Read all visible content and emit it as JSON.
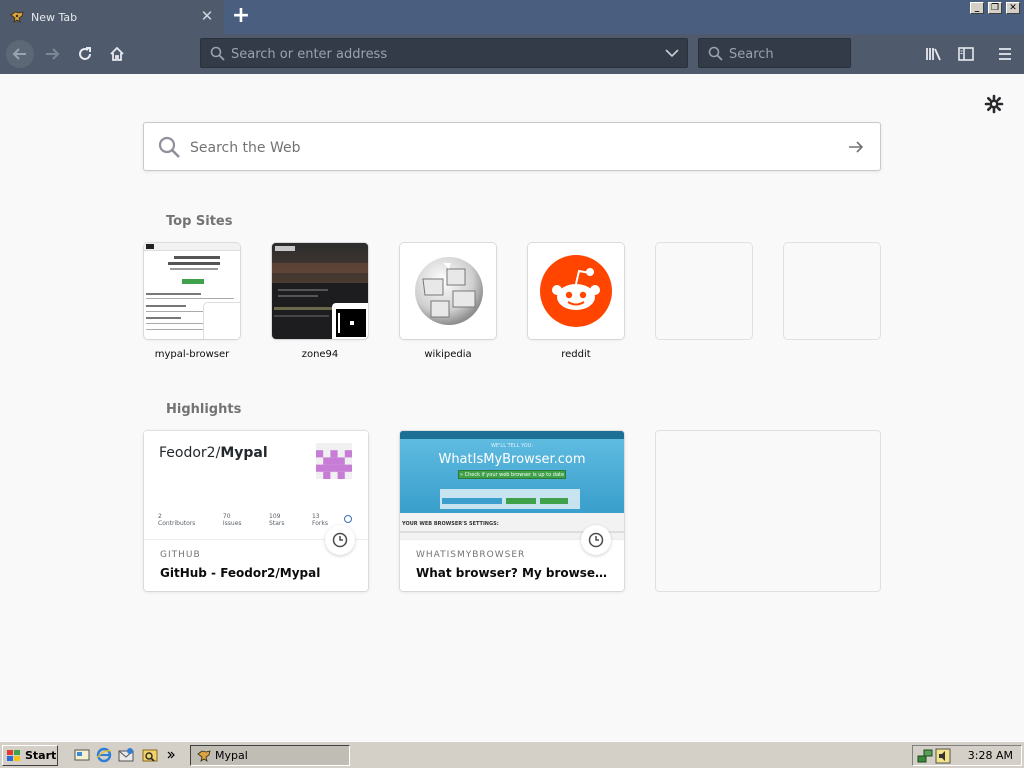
{
  "window": {
    "tab_title": "New Tab",
    "new_tab_symbol": "+",
    "close_tab_symbol": "✕",
    "min_symbol": "_",
    "max_symbol": "❐",
    "close_symbol": "✕"
  },
  "toolbar": {
    "address_placeholder": "Search or enter address",
    "search_placeholder": "Search"
  },
  "newtab": {
    "web_search_placeholder": "Search the Web",
    "top_sites_heading": "Top Sites",
    "highlights_heading": "Highlights",
    "top_sites": [
      {
        "label": "mypal-browser"
      },
      {
        "label": "zone94"
      },
      {
        "label": "wikipedia"
      },
      {
        "label": "reddit"
      }
    ],
    "highlights": [
      {
        "source": "GITHUB",
        "title": "GitHub - Feodor2/Mypal",
        "preview_owner": "Feodor2/",
        "preview_repo": "Mypal",
        "stats": [
          {
            "value": "2",
            "label": "Contributors"
          },
          {
            "value": "70",
            "label": "Issues"
          },
          {
            "value": "109",
            "label": "Stars"
          },
          {
            "value": "13",
            "label": "Forks"
          }
        ]
      },
      {
        "source": "WHATISMYBROWSER",
        "title": "What browser? My browser? Is...",
        "preview_brand": "WhatIsMyBrowser.com",
        "preview_tagline": "WE'LL TELL YOU:",
        "preview_button": "» Check if your web browser is up to date",
        "preview_section": "YOUR WEB BROWSER'S SETTINGS:"
      }
    ]
  },
  "taskbar": {
    "start_label": "Start",
    "active_window": "Mypal",
    "time": "3:28 AM"
  },
  "colors": {
    "tabstrip": "#4a5f7f",
    "toolbar": "#4f5b6c",
    "reddit": "#ff4500",
    "taskbar": "#d4d0c8"
  }
}
